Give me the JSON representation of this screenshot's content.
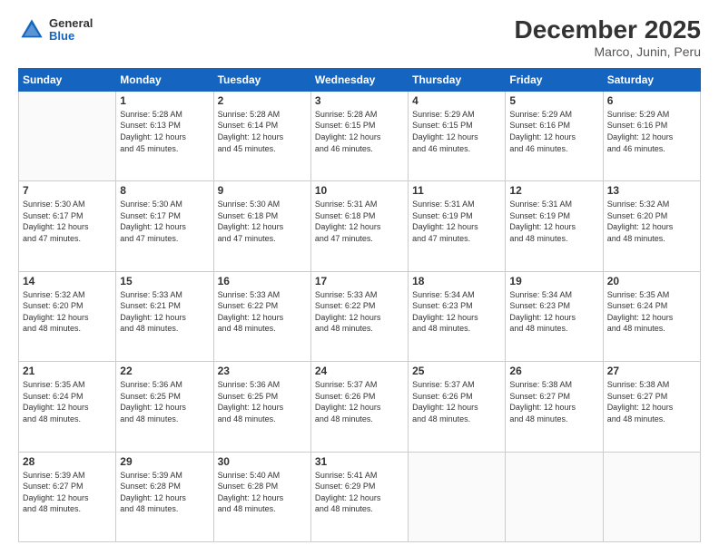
{
  "header": {
    "logo_general": "General",
    "logo_blue": "Blue",
    "title": "December 2025",
    "subtitle": "Marco, Junin, Peru"
  },
  "days_of_week": [
    "Sunday",
    "Monday",
    "Tuesday",
    "Wednesday",
    "Thursday",
    "Friday",
    "Saturday"
  ],
  "weeks": [
    [
      {
        "day": "",
        "info": ""
      },
      {
        "day": "1",
        "info": "Sunrise: 5:28 AM\nSunset: 6:13 PM\nDaylight: 12 hours\nand 45 minutes."
      },
      {
        "day": "2",
        "info": "Sunrise: 5:28 AM\nSunset: 6:14 PM\nDaylight: 12 hours\nand 45 minutes."
      },
      {
        "day": "3",
        "info": "Sunrise: 5:28 AM\nSunset: 6:15 PM\nDaylight: 12 hours\nand 46 minutes."
      },
      {
        "day": "4",
        "info": "Sunrise: 5:29 AM\nSunset: 6:15 PM\nDaylight: 12 hours\nand 46 minutes."
      },
      {
        "day": "5",
        "info": "Sunrise: 5:29 AM\nSunset: 6:16 PM\nDaylight: 12 hours\nand 46 minutes."
      },
      {
        "day": "6",
        "info": "Sunrise: 5:29 AM\nSunset: 6:16 PM\nDaylight: 12 hours\nand 46 minutes."
      }
    ],
    [
      {
        "day": "7",
        "info": "Sunrise: 5:30 AM\nSunset: 6:17 PM\nDaylight: 12 hours\nand 47 minutes."
      },
      {
        "day": "8",
        "info": "Sunrise: 5:30 AM\nSunset: 6:17 PM\nDaylight: 12 hours\nand 47 minutes."
      },
      {
        "day": "9",
        "info": "Sunrise: 5:30 AM\nSunset: 6:18 PM\nDaylight: 12 hours\nand 47 minutes."
      },
      {
        "day": "10",
        "info": "Sunrise: 5:31 AM\nSunset: 6:18 PM\nDaylight: 12 hours\nand 47 minutes."
      },
      {
        "day": "11",
        "info": "Sunrise: 5:31 AM\nSunset: 6:19 PM\nDaylight: 12 hours\nand 47 minutes."
      },
      {
        "day": "12",
        "info": "Sunrise: 5:31 AM\nSunset: 6:19 PM\nDaylight: 12 hours\nand 48 minutes."
      },
      {
        "day": "13",
        "info": "Sunrise: 5:32 AM\nSunset: 6:20 PM\nDaylight: 12 hours\nand 48 minutes."
      }
    ],
    [
      {
        "day": "14",
        "info": "Sunrise: 5:32 AM\nSunset: 6:20 PM\nDaylight: 12 hours\nand 48 minutes."
      },
      {
        "day": "15",
        "info": "Sunrise: 5:33 AM\nSunset: 6:21 PM\nDaylight: 12 hours\nand 48 minutes."
      },
      {
        "day": "16",
        "info": "Sunrise: 5:33 AM\nSunset: 6:22 PM\nDaylight: 12 hours\nand 48 minutes."
      },
      {
        "day": "17",
        "info": "Sunrise: 5:33 AM\nSunset: 6:22 PM\nDaylight: 12 hours\nand 48 minutes."
      },
      {
        "day": "18",
        "info": "Sunrise: 5:34 AM\nSunset: 6:23 PM\nDaylight: 12 hours\nand 48 minutes."
      },
      {
        "day": "19",
        "info": "Sunrise: 5:34 AM\nSunset: 6:23 PM\nDaylight: 12 hours\nand 48 minutes."
      },
      {
        "day": "20",
        "info": "Sunrise: 5:35 AM\nSunset: 6:24 PM\nDaylight: 12 hours\nand 48 minutes."
      }
    ],
    [
      {
        "day": "21",
        "info": "Sunrise: 5:35 AM\nSunset: 6:24 PM\nDaylight: 12 hours\nand 48 minutes."
      },
      {
        "day": "22",
        "info": "Sunrise: 5:36 AM\nSunset: 6:25 PM\nDaylight: 12 hours\nand 48 minutes."
      },
      {
        "day": "23",
        "info": "Sunrise: 5:36 AM\nSunset: 6:25 PM\nDaylight: 12 hours\nand 48 minutes."
      },
      {
        "day": "24",
        "info": "Sunrise: 5:37 AM\nSunset: 6:26 PM\nDaylight: 12 hours\nand 48 minutes."
      },
      {
        "day": "25",
        "info": "Sunrise: 5:37 AM\nSunset: 6:26 PM\nDaylight: 12 hours\nand 48 minutes."
      },
      {
        "day": "26",
        "info": "Sunrise: 5:38 AM\nSunset: 6:27 PM\nDaylight: 12 hours\nand 48 minutes."
      },
      {
        "day": "27",
        "info": "Sunrise: 5:38 AM\nSunset: 6:27 PM\nDaylight: 12 hours\nand 48 minutes."
      }
    ],
    [
      {
        "day": "28",
        "info": "Sunrise: 5:39 AM\nSunset: 6:27 PM\nDaylight: 12 hours\nand 48 minutes."
      },
      {
        "day": "29",
        "info": "Sunrise: 5:39 AM\nSunset: 6:28 PM\nDaylight: 12 hours\nand 48 minutes."
      },
      {
        "day": "30",
        "info": "Sunrise: 5:40 AM\nSunset: 6:28 PM\nDaylight: 12 hours\nand 48 minutes."
      },
      {
        "day": "31",
        "info": "Sunrise: 5:41 AM\nSunset: 6:29 PM\nDaylight: 12 hours\nand 48 minutes."
      },
      {
        "day": "",
        "info": ""
      },
      {
        "day": "",
        "info": ""
      },
      {
        "day": "",
        "info": ""
      }
    ]
  ]
}
